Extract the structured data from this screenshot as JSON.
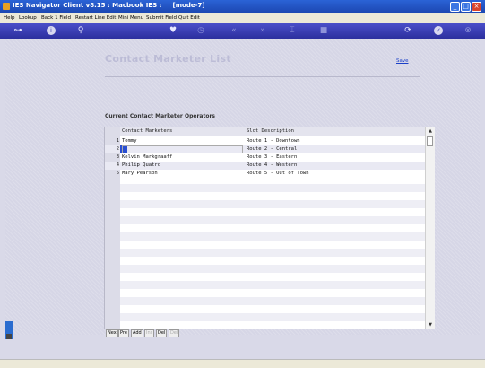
{
  "window": {
    "title": "IES Navigator Client v8.15 : Macbook IES :     [mode-7]"
  },
  "menu": [
    "Help",
    "Lookup",
    "Back 1 Field",
    "Restart Line Edit",
    "Mini Menu",
    "Submit Field",
    "Quit Edit"
  ],
  "toolbar": {
    "icons": [
      "exit-key-icon",
      "info-icon",
      "search-icon",
      "heart-icon",
      "clock-icon",
      "rewind-icon",
      "fast-forward-icon",
      "cursor-icon",
      "stop-icon",
      "save-icon",
      "check-icon",
      "close-icon"
    ]
  },
  "page": {
    "heading": "Contact Marketer List",
    "save_label": "Save",
    "section_label": "Current Contact Marketer Operators"
  },
  "table": {
    "columns": [
      "Contact Marketers",
      "Slot Description"
    ],
    "rows": [
      {
        "num": "1",
        "marketer": "Tommy",
        "slot": "Route 1 - Downtown"
      },
      {
        "num": "2",
        "marketer": "",
        "slot": "Route 2 - Central"
      },
      {
        "num": "3",
        "marketer": "Kelvin Markgraaff",
        "slot": "Route 3 - Eastern"
      },
      {
        "num": "4",
        "marketer": "Philip Quatro",
        "slot": "Route 4 - Western"
      },
      {
        "num": "5",
        "marketer": "Mary Pearson",
        "slot": "Route 5 - Out of Town"
      }
    ]
  },
  "nav": {
    "buttons": [
      "Nex",
      "Pre",
      "Add",
      "Ins",
      "Del",
      "Del"
    ]
  }
}
